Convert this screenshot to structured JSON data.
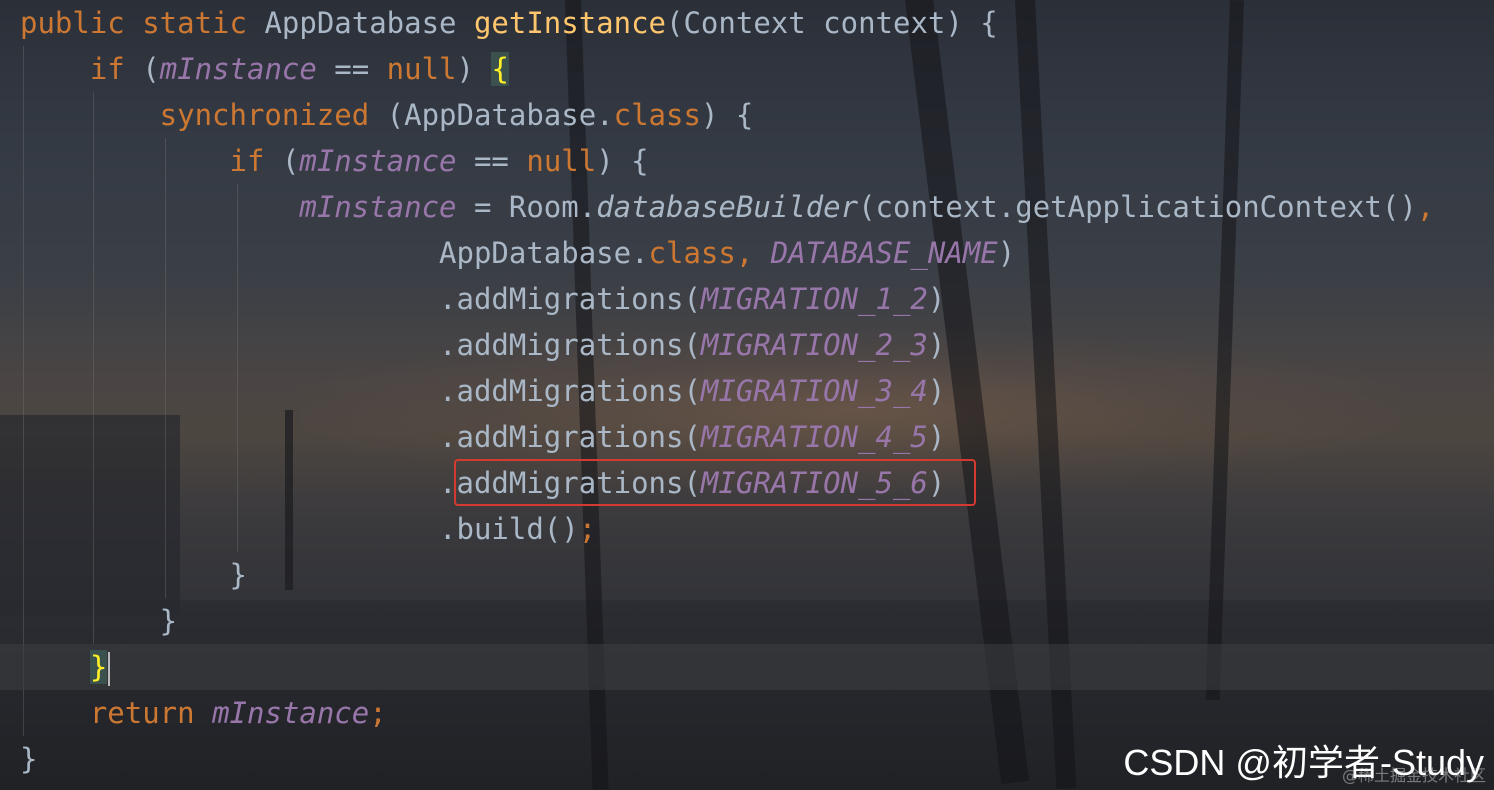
{
  "editor": {
    "lines": [
      [
        {
          "t": "public static ",
          "c": "kw"
        },
        {
          "t": "AppDatabase ",
          "c": "plain"
        },
        {
          "t": "getInstance",
          "c": "fn"
        },
        {
          "t": "(Context context) {",
          "c": "plain"
        }
      ],
      [
        {
          "t": "    if ",
          "c": "kw"
        },
        {
          "t": "(",
          "c": "plain"
        },
        {
          "t": "mInstance",
          "c": "field"
        },
        {
          "t": " == ",
          "c": "plain"
        },
        {
          "t": "null",
          "c": "kw"
        },
        {
          "t": ") ",
          "c": "plain"
        },
        {
          "t": "{",
          "c": "brace-hl"
        }
      ],
      [
        {
          "t": "        synchronized ",
          "c": "kw"
        },
        {
          "t": "(AppDatabase.",
          "c": "plain"
        },
        {
          "t": "class",
          "c": "kw"
        },
        {
          "t": ") {",
          "c": "plain"
        }
      ],
      [
        {
          "t": "            if ",
          "c": "kw"
        },
        {
          "t": "(",
          "c": "plain"
        },
        {
          "t": "mInstance",
          "c": "field"
        },
        {
          "t": " == ",
          "c": "plain"
        },
        {
          "t": "null",
          "c": "kw"
        },
        {
          "t": ") {",
          "c": "plain"
        }
      ],
      [
        {
          "t": "                ",
          "c": "plain"
        },
        {
          "t": "mInstance",
          "c": "field"
        },
        {
          "t": " = Room.",
          "c": "plain"
        },
        {
          "t": "databaseBuilder",
          "c": "static-m"
        },
        {
          "t": "(context.getApplicationContext()",
          "c": "plain"
        },
        {
          "t": ",",
          "c": "kw"
        }
      ],
      [
        {
          "t": "                        AppDatabase.",
          "c": "plain"
        },
        {
          "t": "class, ",
          "c": "kw"
        },
        {
          "t": "DATABASE_NAME",
          "c": "const"
        },
        {
          "t": ")",
          "c": "plain"
        }
      ],
      [
        {
          "t": "                        .addMigrations(",
          "c": "plain"
        },
        {
          "t": "MIGRATION_1_2",
          "c": "const"
        },
        {
          "t": ")",
          "c": "plain"
        }
      ],
      [
        {
          "t": "                        .addMigrations(",
          "c": "plain"
        },
        {
          "t": "MIGRATION_2_3",
          "c": "const"
        },
        {
          "t": ")",
          "c": "plain"
        }
      ],
      [
        {
          "t": "                        .addMigrations(",
          "c": "plain"
        },
        {
          "t": "MIGRATION_3_4",
          "c": "const"
        },
        {
          "t": ")",
          "c": "plain"
        }
      ],
      [
        {
          "t": "                        .addMigrations(",
          "c": "plain"
        },
        {
          "t": "MIGRATION_4_5",
          "c": "const"
        },
        {
          "t": ")",
          "c": "plain"
        }
      ],
      [
        {
          "t": "                        .addMigrations(",
          "c": "plain"
        },
        {
          "t": "MIGRATION_5_6",
          "c": "const"
        },
        {
          "t": ")",
          "c": "plain"
        }
      ],
      [
        {
          "t": "                        .build()",
          "c": "plain"
        },
        {
          "t": ";",
          "c": "kw"
        }
      ],
      [
        {
          "t": "            }",
          "c": "plain"
        }
      ],
      [
        {
          "t": "        }",
          "c": "plain"
        }
      ],
      [
        {
          "t": "    ",
          "c": "plain"
        },
        {
          "t": "}",
          "c": "brace-hl"
        },
        {
          "t": "",
          "c": "cursor"
        }
      ],
      [
        {
          "t": "    return ",
          "c": "kw"
        },
        {
          "t": "mInstance",
          "c": "field"
        },
        {
          "t": ";",
          "c": "kw"
        }
      ],
      [
        {
          "t": "}",
          "c": "plain"
        }
      ]
    ]
  },
  "colors": {
    "keyword": "#cc7832",
    "method": "#ffc66d",
    "field": "#9876aa",
    "text": "#a9b7c6",
    "highlight_border": "#d43a2f",
    "brace_match": "#ffef28"
  },
  "watermark": {
    "main": "CSDN @初学者-Study",
    "sub": "@稀土掘金技术社区"
  }
}
